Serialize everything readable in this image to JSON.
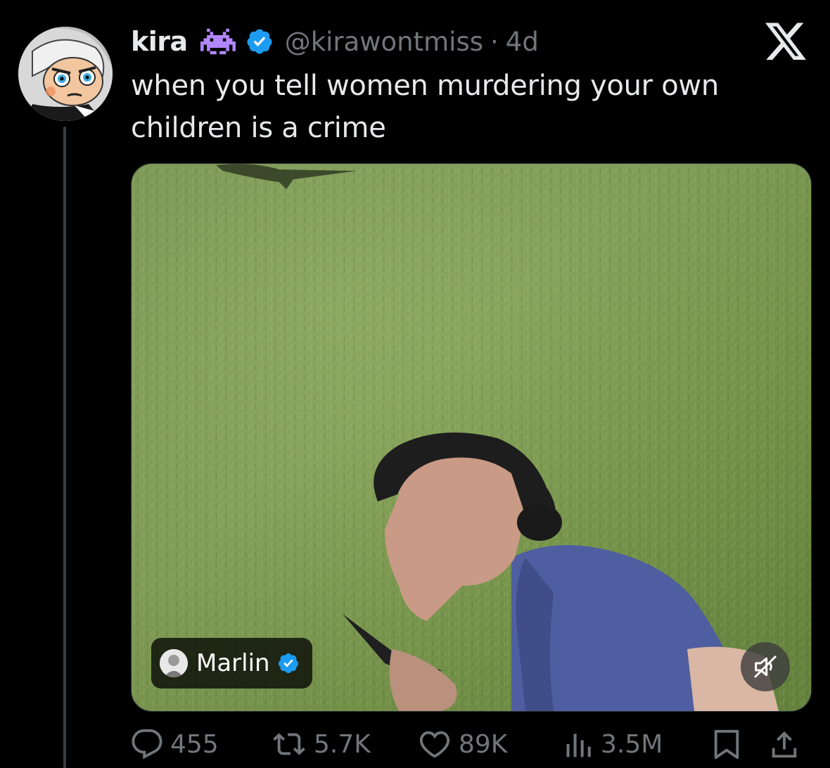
{
  "tweet": {
    "author_name": "kira",
    "emoji_icon": "alien-monster-emoji",
    "handle": "@kirawontmiss",
    "separator": "·",
    "time": "4d",
    "text": "when you tell women murdering your own children is a crime"
  },
  "media": {
    "source_name": "Marlin",
    "source_verified": true,
    "mute_icon": "speaker-muted-icon"
  },
  "actions": {
    "replies": "455",
    "reposts": "5.7K",
    "likes": "89K",
    "views": "3.5M"
  },
  "colors": {
    "background": "#000000",
    "text": "#e7e9ea",
    "muted": "#71767b",
    "verified": "#1d9bf0",
    "emoji": "#b388ff"
  }
}
